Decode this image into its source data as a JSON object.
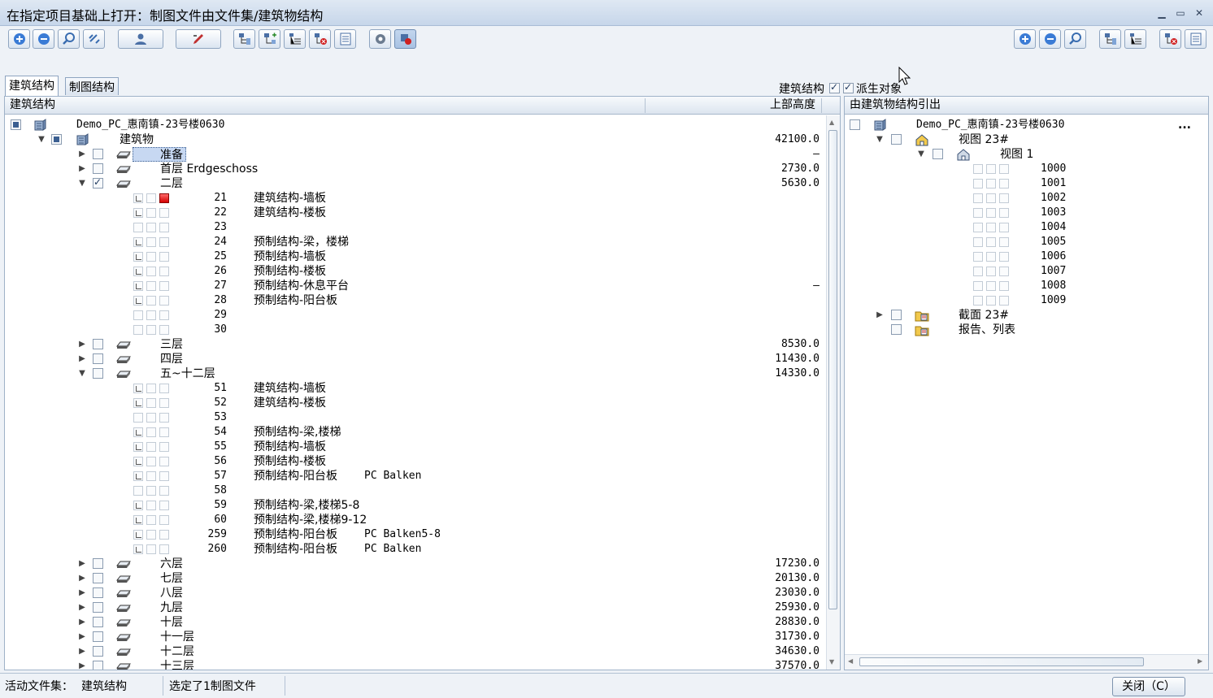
{
  "window": {
    "title": "在指定项目基础上打开：制图文件由文件集/建筑物结构",
    "controls": [
      "minimize-icon",
      "maximize-icon",
      "close-icon"
    ]
  },
  "toolbar": {
    "left_icons": [
      "expand-icon",
      "collapse-icon",
      "search-icon",
      "link-icon",
      "user-icon",
      "pen-icon",
      "tree-structure-icon",
      "tree-add-icon",
      "tree-list-icon",
      "tree-delete-icon",
      "tree-properties-icon",
      "settings-icon",
      "filter-icon"
    ],
    "right_icons": [
      "expand-icon",
      "collapse-icon",
      "search-icon",
      "tree-structure-icon",
      "tree-list-icon",
      "tree-delete-icon",
      "tree-properties-icon"
    ]
  },
  "tabs": [
    {
      "label": "建筑结构",
      "active": true
    },
    {
      "label": "制图结构",
      "active": false
    }
  ],
  "filters": {
    "building_structure_label": "建筑结构",
    "building_structure_checked": true,
    "derived_objects_label": "派生对象",
    "derived_objects_checked": true
  },
  "left_panel": {
    "header_name": "建筑结构",
    "header_height": "上部高度",
    "root": "Demo_PC_惠南镇-23号楼0630",
    "building": {
      "label": "建筑物",
      "height": "42100.0"
    },
    "floors": [
      {
        "label": "准备",
        "height": "–",
        "selected": true,
        "checked": false
      },
      {
        "label": "首层 Erdgeschoss",
        "height": "2730.0",
        "checked": false
      },
      {
        "label": "二层",
        "height": "5630.0",
        "checked": true,
        "expanded": true,
        "files": [
          {
            "num": "21",
            "name": "建筑结构-墙板",
            "red": true
          },
          {
            "num": "22",
            "name": "建筑结构-楼板"
          },
          {
            "num": "23",
            "name": ""
          },
          {
            "num": "24",
            "name": "预制结构-梁，楼梯"
          },
          {
            "num": "25",
            "name": "预制结构-墙板"
          },
          {
            "num": "26",
            "name": "预制结构-楼板"
          },
          {
            "num": "27",
            "name": "预制结构-休息平台",
            "height": "–"
          },
          {
            "num": "28",
            "name": "预制结构-阳台板"
          },
          {
            "num": "29",
            "name": ""
          },
          {
            "num": "30",
            "name": ""
          }
        ]
      },
      {
        "label": "三层",
        "height": "8530.0",
        "checked": false
      },
      {
        "label": "四层",
        "height": "11430.0",
        "checked": false
      },
      {
        "label": "五~十二层",
        "height": "14330.0",
        "checked": false,
        "expanded": true,
        "files": [
          {
            "num": "51",
            "name": "建筑结构-墙板"
          },
          {
            "num": "52",
            "name": "建筑结构-楼板"
          },
          {
            "num": "53",
            "name": ""
          },
          {
            "num": "54",
            "name": "预制结构-梁,楼梯"
          },
          {
            "num": "55",
            "name": "预制结构-墙板"
          },
          {
            "num": "56",
            "name": "预制结构-楼板"
          },
          {
            "num": "57",
            "name": "预制结构-阳台板",
            "extra": "PC Balken"
          },
          {
            "num": "58",
            "name": ""
          },
          {
            "num": "59",
            "name": "预制结构-梁,楼梯5-8"
          },
          {
            "num": "60",
            "name": "预制结构-梁,楼梯9-12"
          },
          {
            "num": "259",
            "name": "预制结构-阳台板",
            "extra": "PC Balken5-8"
          },
          {
            "num": "260",
            "name": "预制结构-阳台板",
            "extra": "PC Balken"
          }
        ]
      },
      {
        "label": "六层",
        "height": "17230.0",
        "checked": false
      },
      {
        "label": "七层",
        "height": "20130.0",
        "checked": false
      },
      {
        "label": "八层",
        "height": "23030.0",
        "checked": false
      },
      {
        "label": "九层",
        "height": "25930.0",
        "checked": false
      },
      {
        "label": "十层",
        "height": "28830.0",
        "checked": false
      },
      {
        "label": "十一层",
        "height": "31730.0",
        "checked": false
      },
      {
        "label": "十二层",
        "height": "34630.0",
        "checked": false
      },
      {
        "label": "十三层",
        "height": "37570.0",
        "checked": false
      }
    ]
  },
  "right_panel": {
    "header": "由建筑物结构引出",
    "root": "Demo_PC_惠南镇-23号楼0630",
    "more": "...",
    "view_group": "视图 23#",
    "view": "视图 1",
    "view_items": [
      "1000",
      "1001",
      "1002",
      "1003",
      "1004",
      "1005",
      "1006",
      "1007",
      "1008",
      "1009"
    ],
    "section": "截面 23#",
    "reports": "报告、列表"
  },
  "status": {
    "active_set_label": "活动文件集：",
    "active_set_value": "建筑结构",
    "selection": "选定了1制图文件",
    "close_button": "关闭（C）"
  }
}
